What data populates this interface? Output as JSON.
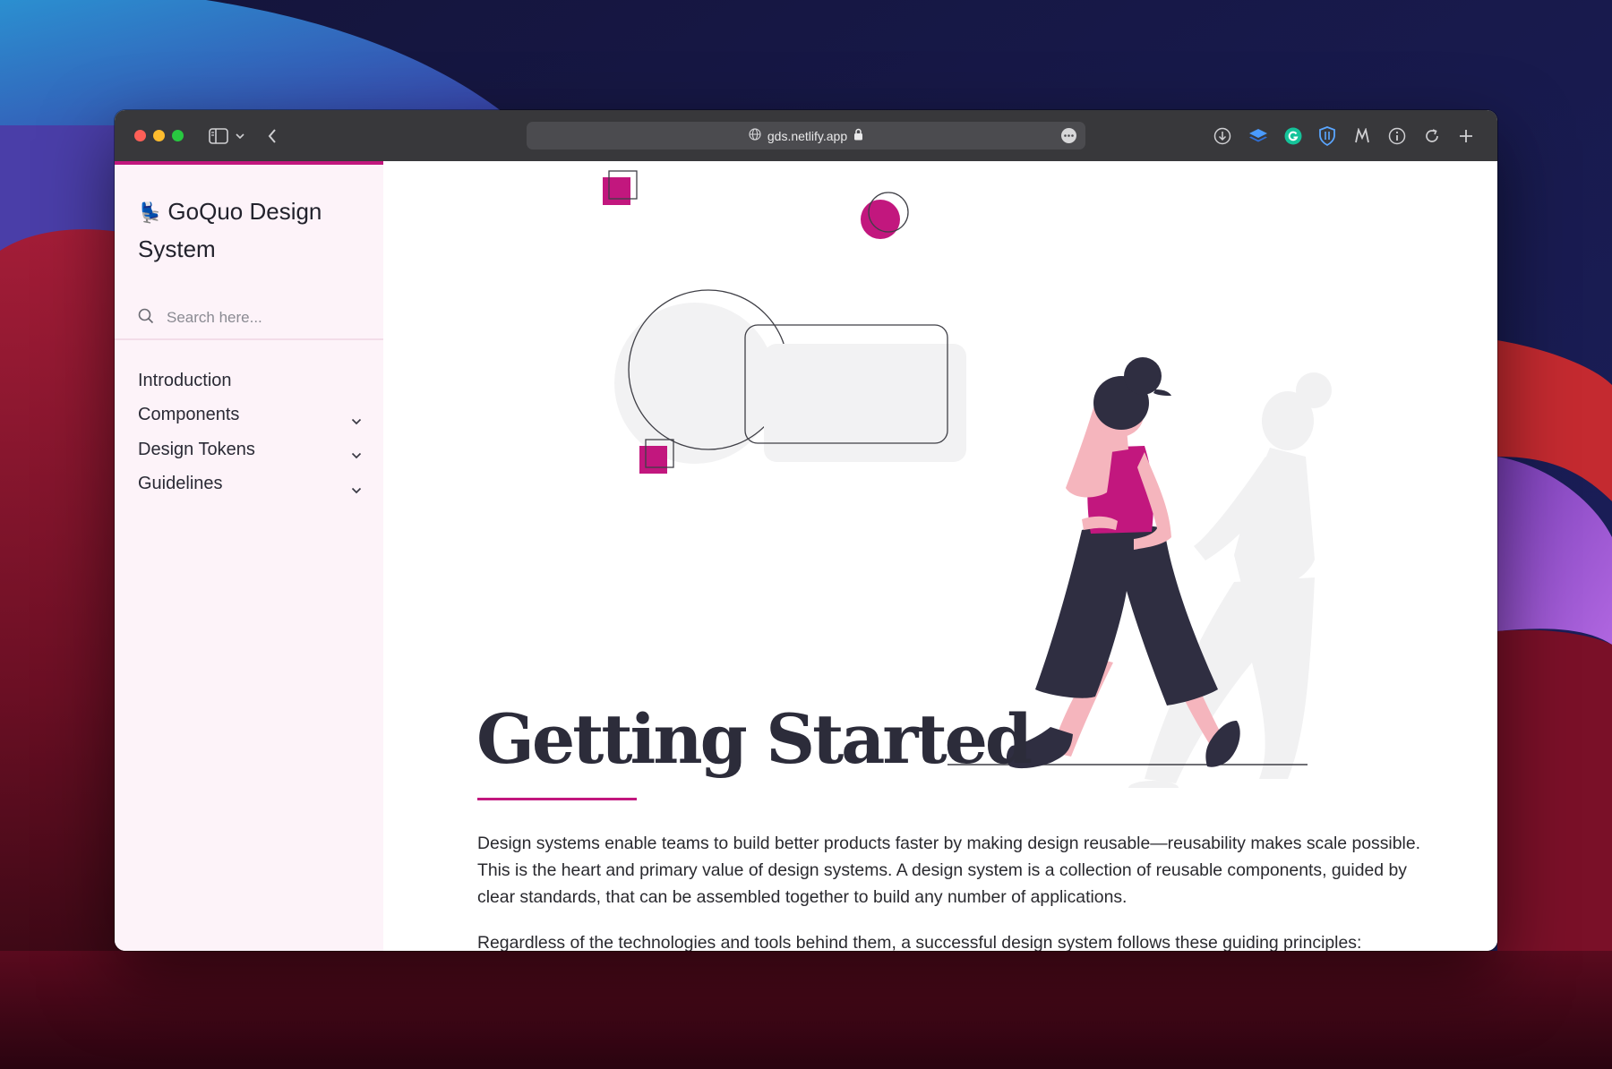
{
  "browser": {
    "url": "gds.netlify.app",
    "toolbar_icons": [
      "sidebar-icon",
      "chevron-down-icon",
      "back-icon",
      "globe-icon",
      "lock-icon",
      "more-icon",
      "download-icon",
      "layers-icon",
      "grammarly-icon",
      "shield-icon",
      "m-icon",
      "info-icon",
      "reload-icon",
      "plus-icon"
    ]
  },
  "sidebar": {
    "brand_emoji": "💺",
    "brand_title": "GoQuo Design System",
    "search_placeholder": "Search here...",
    "nav_items": [
      {
        "label": "Introduction",
        "expandable": false
      },
      {
        "label": "Components",
        "expandable": true
      },
      {
        "label": "Design Tokens",
        "expandable": true
      },
      {
        "label": "Guidelines",
        "expandable": true
      }
    ]
  },
  "main": {
    "title": "Getting Started",
    "paragraphs": [
      "Design systems enable teams to build better products faster by making design reusable—reusability makes scale possible. This is the heart and primary value of design systems. A design system is a collection of reusable components, guided by clear standards, that can be assembled together to build any number of applications.",
      "Regardless of the technologies and tools behind them, a successful design system follows these guiding principles:"
    ]
  },
  "colors": {
    "accent": "#c2177e",
    "sidebar_bg": "#fdf3f9",
    "titlebar_bg": "#38383b",
    "text_dark": "#2c2c3a"
  }
}
